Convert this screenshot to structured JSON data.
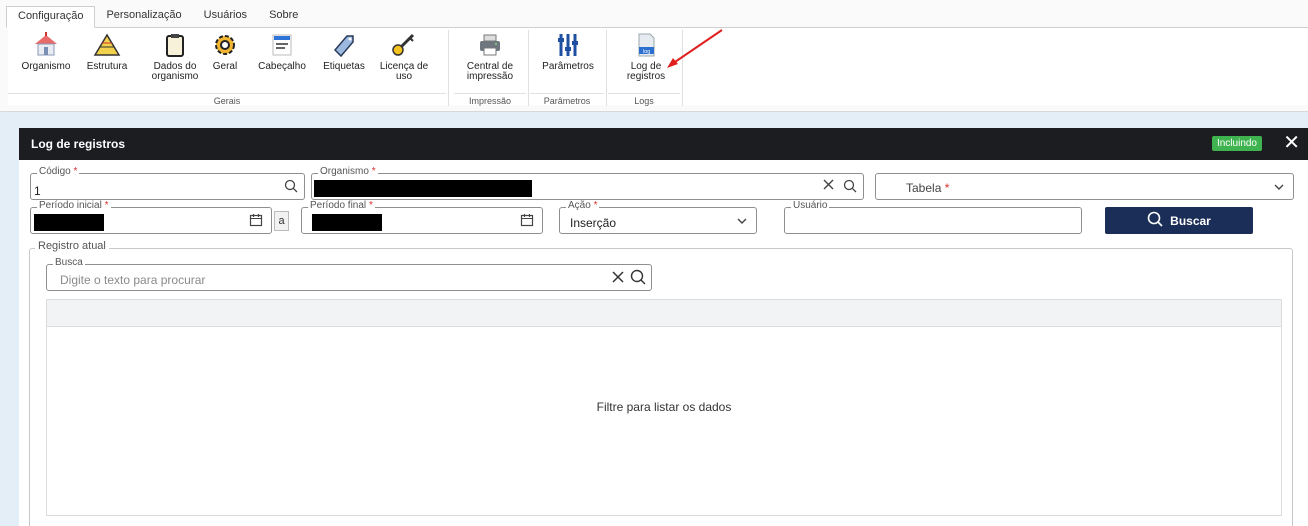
{
  "tabs": [
    "Configuração",
    "Personalização",
    "Usuários",
    "Sobre"
  ],
  "ribbon": {
    "organismo": "Organismo",
    "estrutura": "Estrutura",
    "dados_l1": "Dados do",
    "dados_l2": "organismo",
    "geral": "Geral",
    "cabecalho": "Cabeçalho",
    "etiquetas": "Etiquetas",
    "licenca_l1": "Licença de",
    "licenca_l2": "uso",
    "central_l1": "Central de",
    "central_l2": "impressão",
    "parametros": "Parâmetros",
    "log_l1": "Log de",
    "log_l2": "registros",
    "log_icon_text": "log",
    "groups": {
      "gerais": "Gerais",
      "impressao": "Impressão",
      "parametros": "Parâmetros",
      "logs": "Logs"
    }
  },
  "dialog": {
    "title": "Log de registros",
    "badge": "Incluindo",
    "close": "✕"
  },
  "form": {
    "codigo_label": "Código",
    "codigo_value": "1",
    "organismo_label": "Organismo",
    "tabela_placeholder": "Tabela",
    "periodo_inicial_label": "Período inicial",
    "a_sep": "a",
    "periodo_final_label": "Período final",
    "acao_label": "Ação",
    "acao_value": "Inserção",
    "usuario_label": "Usuário",
    "required_mark": "*",
    "buscar": "Buscar"
  },
  "registro": {
    "legend": "Registro atual",
    "busca_label": "Busca",
    "busca_placeholder": "Digite o texto para procurar",
    "empty_message": "Filtre para listar os dados"
  },
  "icons": {
    "search": "search-icon",
    "clear": "clear-icon",
    "calendar": "calendar-icon",
    "chevron": "chevron-down-icon"
  },
  "colors": {
    "header_bg": "#1c1d21",
    "badge": "#3fb34f",
    "buscar_bg": "#1b2e57",
    "required": "#d9302c",
    "arrow": "#e02020"
  }
}
